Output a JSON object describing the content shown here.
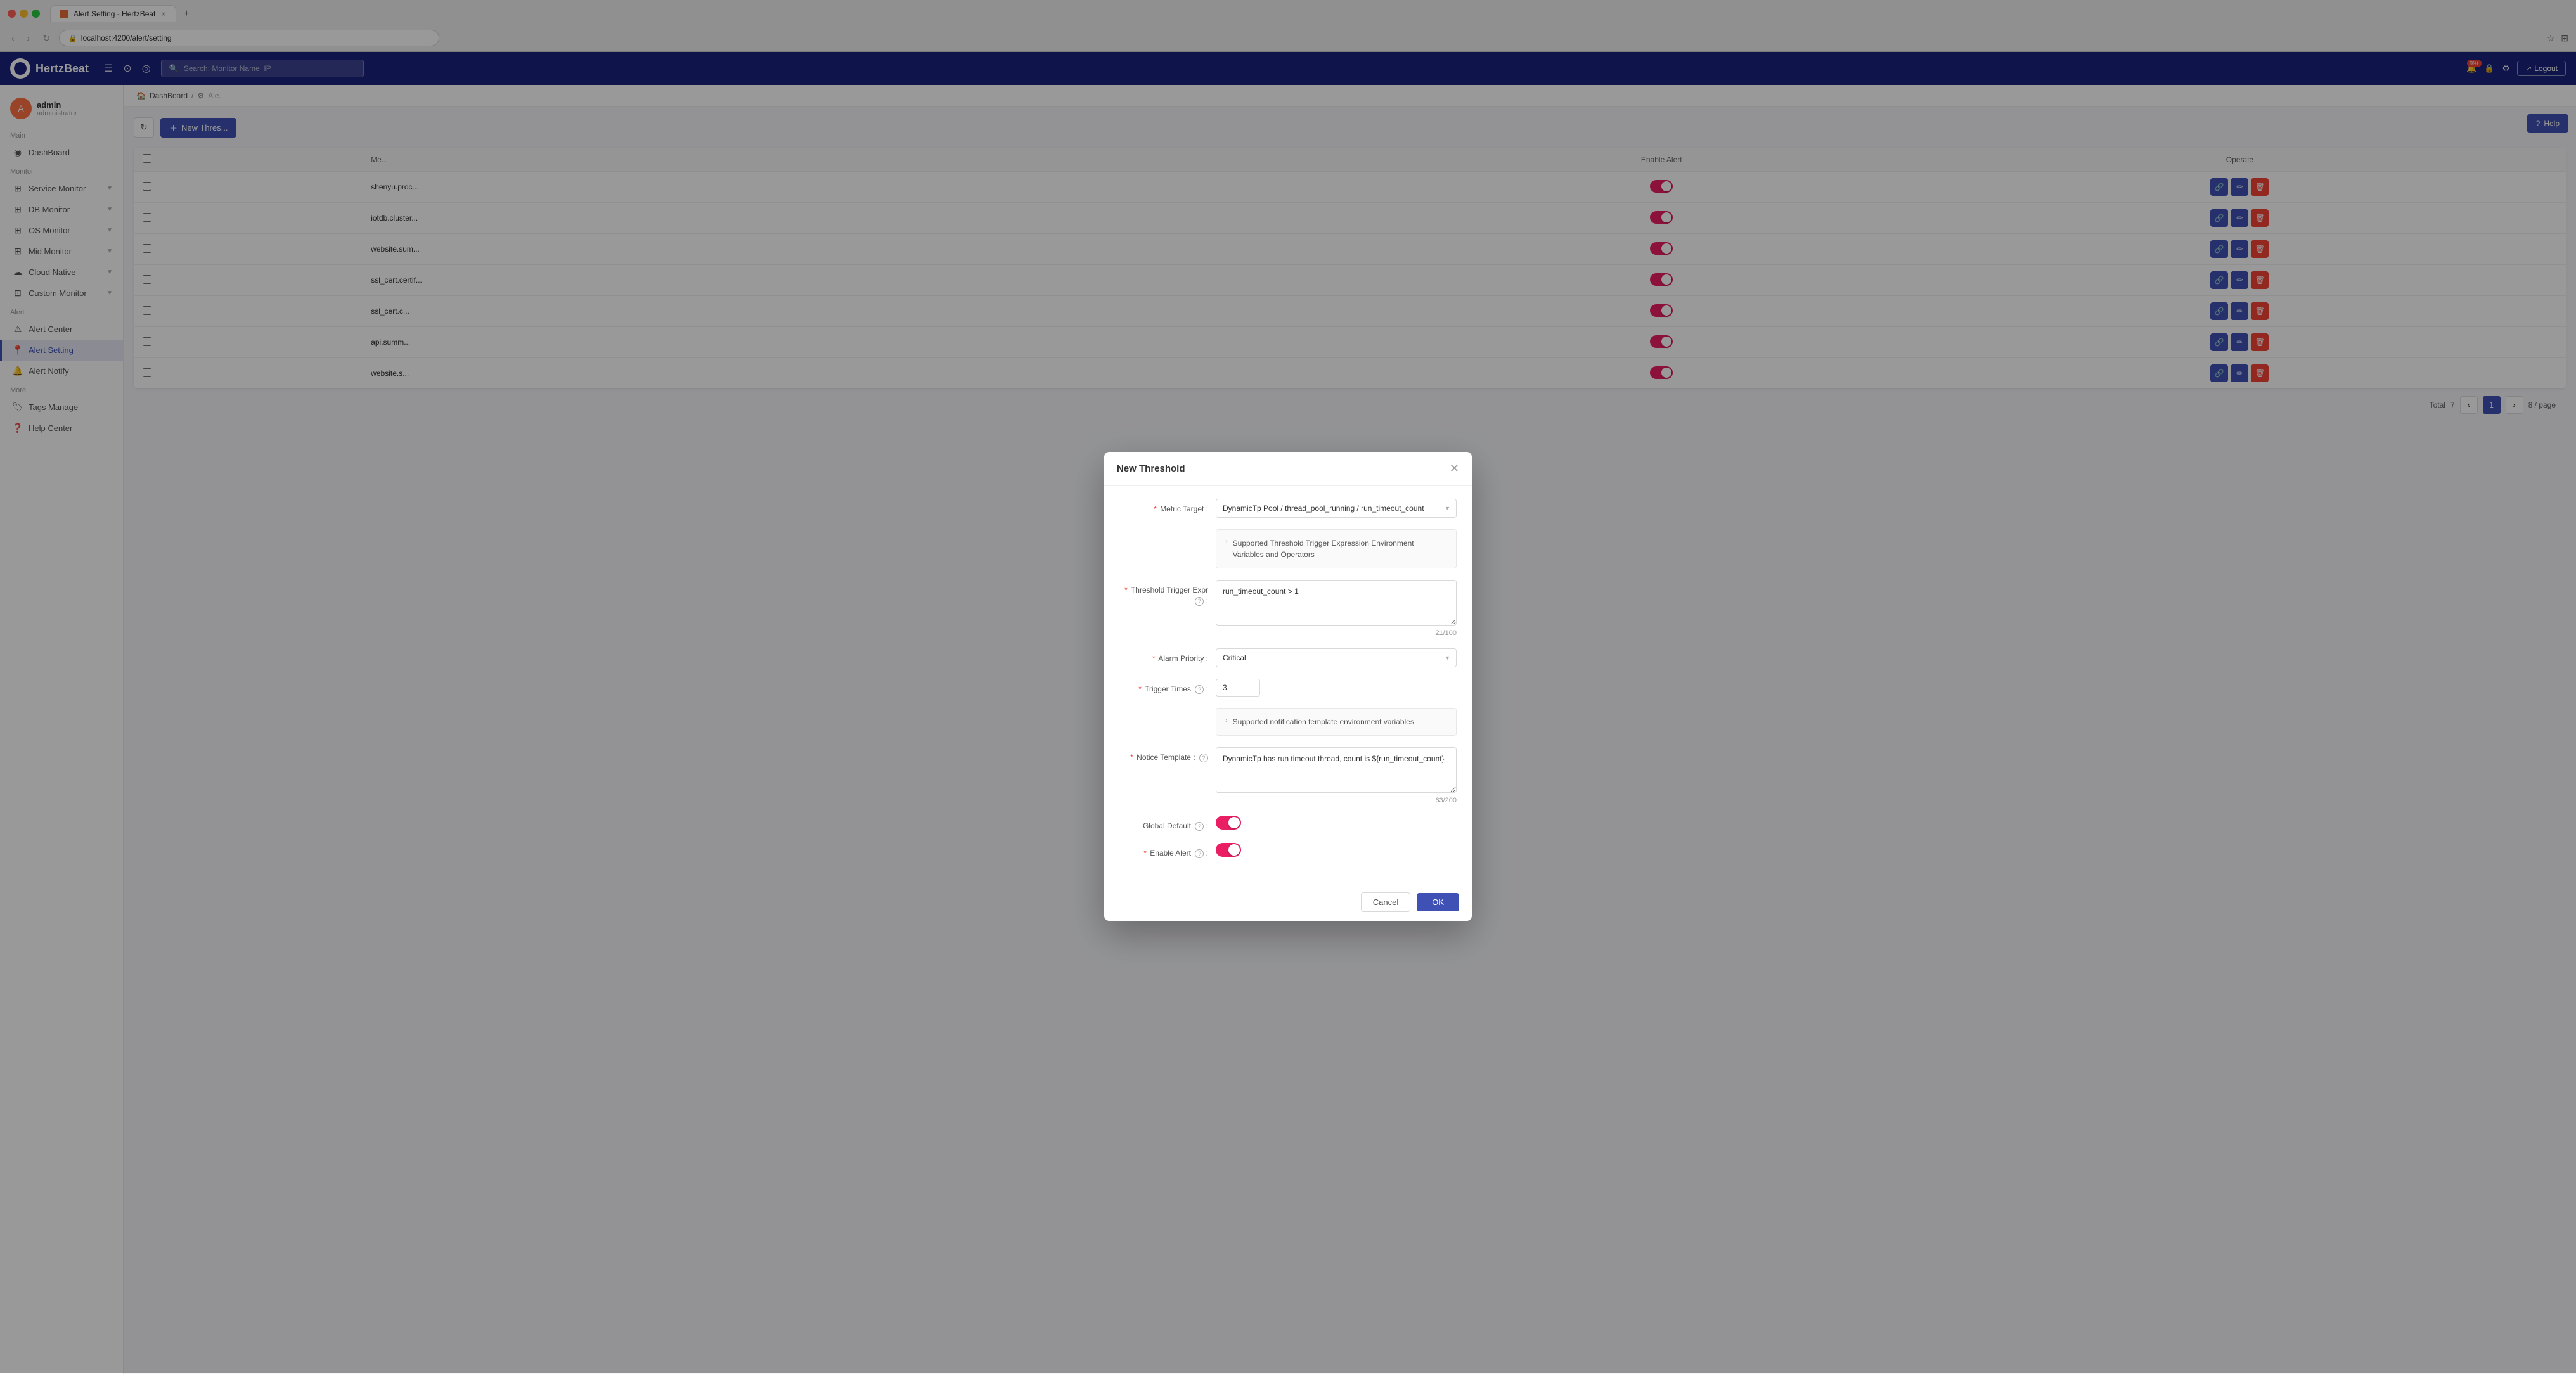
{
  "browser": {
    "tab_title": "Alert Setting - HertzBeat",
    "url": "localhost:4200/alert/setting",
    "new_tab_icon": "+"
  },
  "topnav": {
    "logo_text": "HertzBeat",
    "search_placeholder": "Search: Monitor Name  IP",
    "notification_count": "99+",
    "logout_label": "Logout"
  },
  "sidebar": {
    "user_name": "admin",
    "user_role": "administrator",
    "main_label": "Main",
    "dashboard_label": "DashBoard",
    "monitor_label": "Monitor",
    "service_monitor_label": "Service Monitor",
    "db_monitor_label": "DB Monitor",
    "os_monitor_label": "OS Monitor",
    "mid_monitor_label": "Mid Monitor",
    "cloud_native_label": "Cloud Native",
    "custom_monitor_label": "Custom Monitor",
    "alert_label": "Alert",
    "alert_center_label": "Alert Center",
    "alert_setting_label": "Alert Setting",
    "alert_notify_label": "Alert Notify",
    "more_label": "More",
    "tags_manage_label": "Tags Manage",
    "help_center_label": "Help Center"
  },
  "breadcrumb": {
    "dashboard": "DashBoard",
    "alert": "Alert",
    "separator": "/"
  },
  "toolbar": {
    "new_threshold_label": "New Thres..."
  },
  "table": {
    "headers": [
      "",
      "Me...",
      "",
      "",
      "",
      "Enable Alert",
      "Operate"
    ],
    "rows": [
      {
        "name": "shenyu.proc...",
        "enable": true
      },
      {
        "name": "iotdb.cluster...",
        "enable": true
      },
      {
        "name": "website.sum...",
        "enable": true
      },
      {
        "name": "ssl_cert.certif...",
        "enable": true
      },
      {
        "name": "ssl_cert.c...",
        "enable": true
      },
      {
        "name": "api.summ...",
        "enable": true
      },
      {
        "name": "website.s...",
        "enable": true
      }
    ],
    "total_label": "Total",
    "total_count": "7",
    "page_current": "1",
    "page_size": "8 / page"
  },
  "modal": {
    "title": "New Threshold",
    "metric_target_label": "Metric Target :",
    "metric_target_value": "DynamicTp Pool / thread_pool_running / run_timeout_count",
    "supported_expr_label": "Supported Threshold Trigger Expression Environment Variables and Operators",
    "threshold_trigger_label": "Threshold Trigger Expr",
    "threshold_trigger_value": "run_timeout_count > 1",
    "threshold_counter": "21/100",
    "alarm_priority_label": "Alarm Priority :",
    "alarm_priority_value": "Critical",
    "trigger_times_label": "Trigger Times",
    "trigger_times_value": "3",
    "supported_notify_label": "Supported notification template environment variables",
    "notice_template_label": "Notice Template :",
    "notice_template_value": "DynamicTp has run timeout thread, count is ${run_timeout_count}",
    "notice_counter": "63/200",
    "global_default_label": "Global Default",
    "enable_alert_label": "Enable Alert",
    "cancel_label": "Cancel",
    "ok_label": "OK"
  },
  "help": {
    "label": "Help"
  }
}
